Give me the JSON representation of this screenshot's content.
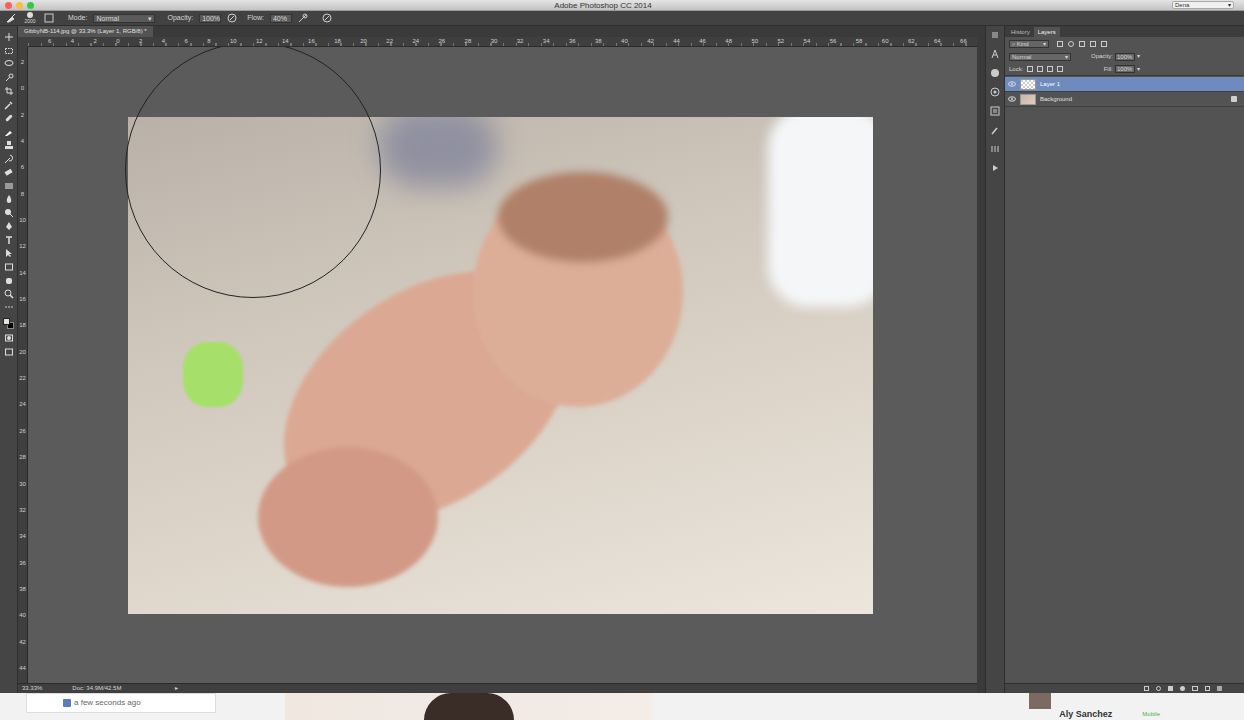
{
  "window": {
    "title": "Adobe Photoshop CC 2014",
    "workspace": "Dena"
  },
  "options_bar": {
    "brush_size": "2000",
    "mode_label": "Mode:",
    "mode": "Normal",
    "opacity_label": "Opacity:",
    "opacity": "100%",
    "flow_label": "Flow:",
    "flow": "40%"
  },
  "document": {
    "tab": "GibbyNB-114.jpg @ 33.3% (Layer 1, RGB/8) *"
  },
  "ruler": {
    "top": [
      "6",
      "4",
      "2",
      "0",
      "2",
      "4",
      "6",
      "8",
      "10",
      "12",
      "14",
      "16",
      "18",
      "20",
      "22",
      "24",
      "26",
      "28",
      "30",
      "32",
      "34",
      "36",
      "38",
      "40",
      "42",
      "44",
      "46",
      "48",
      "50",
      "52",
      "54",
      "56",
      "58",
      "60",
      "62",
      "64",
      "66"
    ],
    "left": [
      "2",
      "0",
      "2",
      "4",
      "6",
      "8",
      "10",
      "12",
      "14",
      "16",
      "18",
      "20",
      "22",
      "24",
      "26",
      "28",
      "30",
      "32",
      "34",
      "36",
      "38",
      "40",
      "42",
      "44"
    ]
  },
  "panel": {
    "tabs": [
      {
        "label": "History",
        "selected": false
      },
      {
        "label": "Layers",
        "selected": true
      }
    ],
    "filter": "Kind",
    "blend_mode": "Normal",
    "opacity_label": "Opacity:",
    "opacity": "100%",
    "lock_label": "Lock:",
    "fill_label": "Fill:",
    "fill": "100%",
    "layers": [
      {
        "name": "Layer 1",
        "visible": true,
        "selected": true,
        "locked": false
      },
      {
        "name": "Background",
        "visible": true,
        "selected": false,
        "locked": true
      }
    ]
  },
  "status_bar": {
    "zoom": "33.33%",
    "doc": "Doc: 34.9M/42.5M"
  },
  "background_page": {
    "timestamp": "a few seconds ago",
    "user": "Aly Sanchez",
    "badge": "Mobile"
  }
}
